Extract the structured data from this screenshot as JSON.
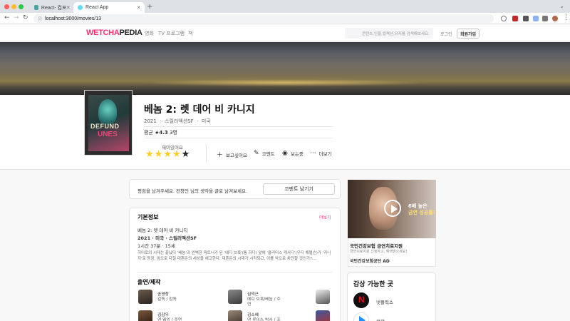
{
  "browser": {
    "tabs": [
      {
        "label": "React- 컴포넌트 간 통신 , Contex",
        "active": false
      },
      {
        "label": "React App",
        "active": true
      }
    ],
    "url": "localhost:3000/movies/13"
  },
  "site": {
    "logo_part1": "WETCHA",
    "logo_part2": "PEDIA",
    "nav": [
      "영화",
      "TV 프로그램",
      "책"
    ],
    "search_placeholder": "콘텐츠,인물,컬렉션,유저를 검색해보세요.",
    "login": "로그인",
    "signup": "회원가입"
  },
  "movie": {
    "poster_text_line1": "DEFUND",
    "poster_text_line2": "UNES",
    "title": "베놈 2: 렛 데어 비 카니지",
    "year": "2021",
    "genre": "스릴러액션SF",
    "country": "미국",
    "avg_label": "평균",
    "avg_value": "★4.3",
    "avg_count": "3명",
    "rating_label": "재미있어요",
    "rating": 4,
    "actions": [
      "보고싶어요",
      "코멘트",
      "보는중",
      "더보기"
    ]
  },
  "comment_prompt": {
    "text": "평점을 남겨주세요. 전창민 님의 생각을 글로 남겨보세요.",
    "button": "코멘트 남기기"
  },
  "basic_info": {
    "title": "기본정보",
    "more": "더보기",
    "line1": "베놈 2: 렛 데어 비 카니지",
    "line2": "2021 · 미국 · 스릴러액션SF",
    "line3": "1시간 37분 · 15세",
    "synopsis": "히어로의 시대는 끝났다 '베놈'과 완벽한 파트너가 된 '에디 브룩'(톰 하디) 앞에 '클리터스 캐서디'(우디 해럴슨)가 '카니지'로 등장, 앞으로 다칠 대혼돈의 세상을 예고한다. 대혼돈의 시대가 시작되고, 이를 악으로 차단할 것인가?...."
  },
  "cast": {
    "title": "출연/제작",
    "items": [
      {
        "name": "송영창",
        "role": "감독 / 감독",
        "role2": ""
      },
      {
        "name": "심덕근",
        "role": "에디 브룩/베놈 / 주",
        "role2": "연"
      },
      {
        "name": "",
        "role": "",
        "role2": ""
      },
      {
        "name": "김감우",
        "role": "앤 웨잉 / 주연",
        "role2": ""
      },
      {
        "name": "김소혜",
        "role": "댄 루이스 박사 / 조",
        "role2": ""
      },
      {
        "name": "",
        "role": "",
        "role2": ""
      }
    ]
  },
  "ad": {
    "caption_line1": "6배 높은",
    "caption_line2": "금연 성공률!",
    "title": "국민건강보험 금연치료지원",
    "sub": "금연치료지원 신청하고, 혜택받으세요!",
    "sponsor": "국민건강보험공단 AD"
  },
  "where": {
    "title": "감상 가능한 곳",
    "services": [
      "넷플릭스",
      "왓챠"
    ]
  },
  "colors": {
    "brand": "#ff2f6e",
    "star": "#ffcd1f",
    "netflix": "#e50914",
    "watcha": "#1e90ff"
  }
}
